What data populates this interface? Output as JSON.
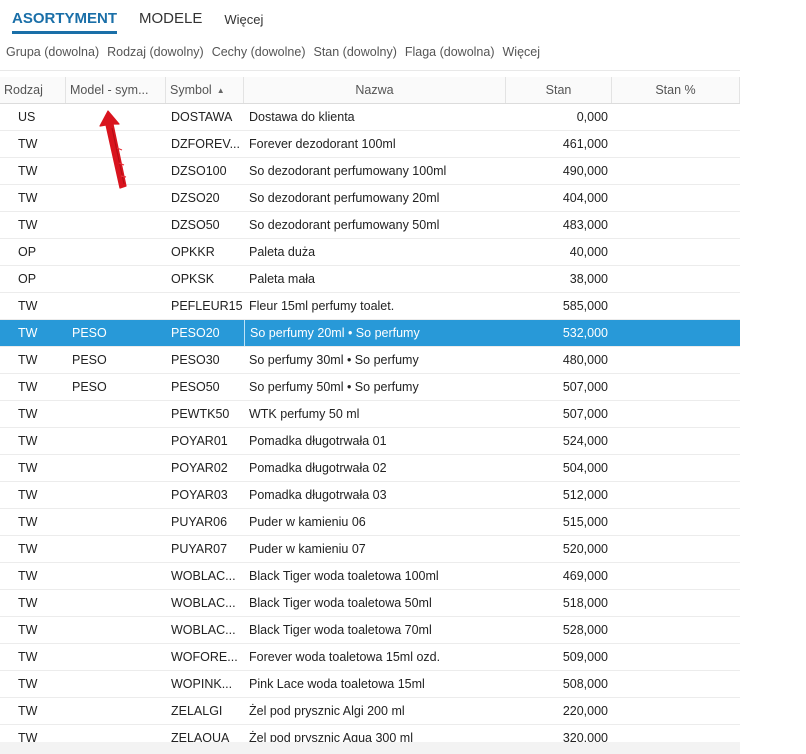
{
  "tabs": [
    {
      "label": "ASORTYMENT"
    },
    {
      "label": "MODELE"
    },
    {
      "label": "Więcej"
    }
  ],
  "filters": [
    {
      "label": "Grupa (dowolna)"
    },
    {
      "label": "Rodzaj (dowolny)"
    },
    {
      "label": "Cechy (dowolne)"
    },
    {
      "label": "Stan (dowolny)"
    },
    {
      "label": "Flaga (dowolna)"
    },
    {
      "label": "Więcej"
    }
  ],
  "columns": {
    "rodzaj": "Rodzaj",
    "model": "Model - sym...",
    "symbol": "Symbol",
    "nazwa": "Nazwa",
    "stan": "Stan",
    "stan_pct": "Stan %"
  },
  "sort_indicator": "▲",
  "rows": [
    {
      "rodzaj": "US",
      "model": "",
      "symbol": "DOSTAWA",
      "nazwa": "Dostawa do klienta",
      "stan": "0,000",
      "stan_pct": ""
    },
    {
      "rodzaj": "TW",
      "model": "",
      "symbol": "DZFOREV...",
      "nazwa": "Forever dezodorant 100ml",
      "stan": "461,000",
      "stan_pct": ""
    },
    {
      "rodzaj": "TW",
      "model": "",
      "symbol": "DZSO100",
      "nazwa": "So dezodorant perfumowany 100ml",
      "stan": "490,000",
      "stan_pct": ""
    },
    {
      "rodzaj": "TW",
      "model": "",
      "symbol": "DZSO20",
      "nazwa": "So dezodorant perfumowany 20ml",
      "stan": "404,000",
      "stan_pct": ""
    },
    {
      "rodzaj": "TW",
      "model": "",
      "symbol": "DZSO50",
      "nazwa": "So dezodorant perfumowany 50ml",
      "stan": "483,000",
      "stan_pct": ""
    },
    {
      "rodzaj": "OP",
      "model": "",
      "symbol": "OPKKR",
      "nazwa": "Paleta duża",
      "stan": "40,000",
      "stan_pct": ""
    },
    {
      "rodzaj": "OP",
      "model": "",
      "symbol": "OPKSK",
      "nazwa": "Paleta mała",
      "stan": "38,000",
      "stan_pct": ""
    },
    {
      "rodzaj": "TW",
      "model": "",
      "symbol": "PEFLEUR15",
      "nazwa": "Fleur 15ml perfumy toalet.",
      "stan": "585,000",
      "stan_pct": ""
    },
    {
      "rodzaj": "TW",
      "model": "PESO",
      "symbol": "PESO20",
      "nazwa": "So perfumy 20ml  • So perfumy",
      "stan": "532,000",
      "stan_pct": "",
      "selected": true
    },
    {
      "rodzaj": "TW",
      "model": "PESO",
      "symbol": "PESO30",
      "nazwa": "So perfumy 30ml • So perfumy",
      "stan": "480,000",
      "stan_pct": ""
    },
    {
      "rodzaj": "TW",
      "model": "PESO",
      "symbol": "PESO50",
      "nazwa": "So perfumy 50ml • So perfumy",
      "stan": "507,000",
      "stan_pct": ""
    },
    {
      "rodzaj": "TW",
      "model": "",
      "symbol": "PEWTK50",
      "nazwa": "WTK perfumy 50 ml",
      "stan": "507,000",
      "stan_pct": ""
    },
    {
      "rodzaj": "TW",
      "model": "",
      "symbol": "POYAR01",
      "nazwa": "Pomadka długotrwała 01",
      "stan": "524,000",
      "stan_pct": ""
    },
    {
      "rodzaj": "TW",
      "model": "",
      "symbol": "POYAR02",
      "nazwa": "Pomadka długotrwała 02",
      "stan": "504,000",
      "stan_pct": ""
    },
    {
      "rodzaj": "TW",
      "model": "",
      "symbol": "POYAR03",
      "nazwa": "Pomadka długotrwała 03",
      "stan": "512,000",
      "stan_pct": ""
    },
    {
      "rodzaj": "TW",
      "model": "",
      "symbol": "PUYAR06",
      "nazwa": "Puder w kamieniu 06",
      "stan": "515,000",
      "stan_pct": ""
    },
    {
      "rodzaj": "TW",
      "model": "",
      "symbol": "PUYAR07",
      "nazwa": "Puder w kamieniu 07",
      "stan": "520,000",
      "stan_pct": ""
    },
    {
      "rodzaj": "TW",
      "model": "",
      "symbol": "WOBLAC...",
      "nazwa": "Black Tiger woda toaletowa 100ml",
      "stan": "469,000",
      "stan_pct": ""
    },
    {
      "rodzaj": "TW",
      "model": "",
      "symbol": "WOBLAC...",
      "nazwa": "Black Tiger woda toaletowa 50ml",
      "stan": "518,000",
      "stan_pct": ""
    },
    {
      "rodzaj": "TW",
      "model": "",
      "symbol": "WOBLAC...",
      "nazwa": "Black Tiger woda toaletowa 70ml",
      "stan": "528,000",
      "stan_pct": ""
    },
    {
      "rodzaj": "TW",
      "model": "",
      "symbol": "WOFORE...",
      "nazwa": "Forever woda toaletowa 15ml ozd.",
      "stan": "509,000",
      "stan_pct": ""
    },
    {
      "rodzaj": "TW",
      "model": "",
      "symbol": "WOPINK...",
      "nazwa": "Pink Lace woda toaletowa 15ml",
      "stan": "508,000",
      "stan_pct": ""
    },
    {
      "rodzaj": "TW",
      "model": "",
      "symbol": "ZELALGI",
      "nazwa": "Żel pod prysznic Algi 200 ml",
      "stan": "220,000",
      "stan_pct": ""
    },
    {
      "rodzaj": "TW",
      "model": "",
      "symbol": "ZELAQUA",
      "nazwa": "Żel pod prysznic Aqua 300 ml",
      "stan": "320,000",
      "stan_pct": ""
    }
  ],
  "colors": {
    "accent": "#1a6fa8",
    "selection": "#2899d8",
    "annotation": "#d9141e"
  },
  "icons": {
    "sort": "sort-ascending-icon",
    "annotation": "red-arrow-annotation"
  }
}
